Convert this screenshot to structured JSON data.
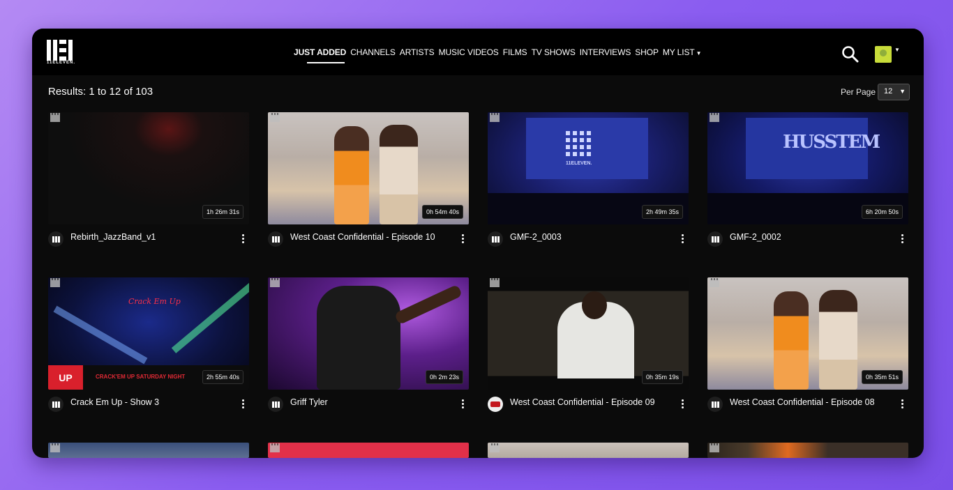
{
  "brand": {
    "logo_text": "11ELEVEN."
  },
  "nav": {
    "items": [
      "JUST ADDED",
      "CHANNELS",
      "ARTISTS",
      "MUSIC VIDEOS",
      "FILMS",
      "TV SHOWS",
      "INTERVIEWS",
      "SHOP",
      "MY LIST"
    ],
    "active": "JUST ADDED"
  },
  "results": {
    "summary": "Results: 1 to 12 of 103"
  },
  "per_page": {
    "label": "Per Page",
    "value": "12"
  },
  "videos": [
    {
      "title": "Rebirth_JazzBand_v1",
      "duration": "1h 26m 31s",
      "scene": "dark"
    },
    {
      "title": "West Coast Confidential - Episode 10",
      "duration": "0h 54m 40s",
      "scene": "party"
    },
    {
      "title": "GMF-2_0003",
      "duration": "2h 49m 35s",
      "scene": "stage-blue"
    },
    {
      "title": "GMF-2_0002",
      "duration": "6h 20m 50s",
      "scene": "stage-hustle"
    },
    {
      "title": "Crack Em Up - Show 3",
      "duration": "2h 55m 40s",
      "scene": "comedy"
    },
    {
      "title": "Griff Tyler",
      "duration": "0h 2m 23s",
      "scene": "purple"
    },
    {
      "title": "West Coast Confidential - Episode 09",
      "duration": "0h 35m 19s",
      "scene": "street"
    },
    {
      "title": "West Coast Confidential - Episode 08",
      "duration": "0h 35m 51s",
      "scene": "party"
    }
  ],
  "thumb_text": {
    "stage_brand": "11ELEVEN.",
    "hustle_word": "HUSSTEM",
    "comedy_logo": "Crack Em Up",
    "comedy_badge": "UP",
    "comedy_banner": "CRACK'EM UP SATURDAY NIGHT"
  }
}
